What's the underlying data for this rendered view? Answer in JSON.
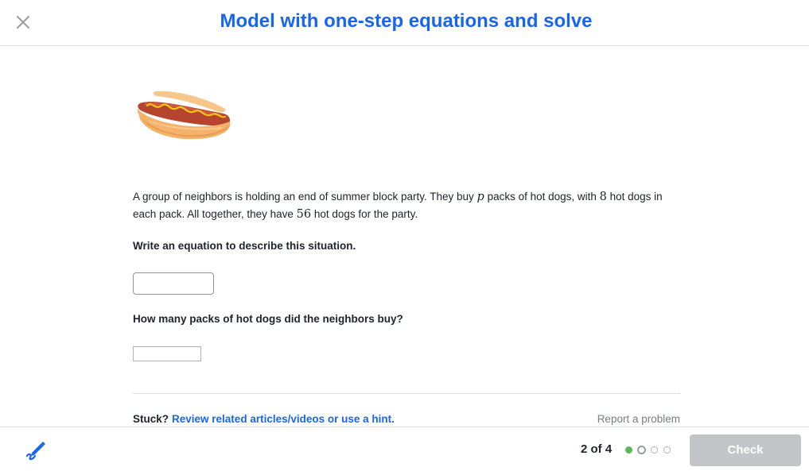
{
  "header": {
    "title": "Model with one-step equations and solve",
    "close_icon": "close-icon"
  },
  "problem": {
    "image_icon": "hot-dog-illustration",
    "text_part1": "A group of neighbors is holding an end of summer block party. They buy ",
    "var_p": "p",
    "text_part2": " packs of hot dogs, with ",
    "num_8": "8",
    "text_part3": " hot dogs in each pack. All together, they have ",
    "num_56": "56",
    "text_part4": " hot dogs for the party.",
    "question1": "Write an equation to describe this situation.",
    "answer1_value": "",
    "question2": "How many packs of hot dogs did the neighbors buy?",
    "answer2_value": ""
  },
  "help": {
    "stuck_label": "Stuck?",
    "stuck_link": "Review related articles/videos or use a hint.",
    "report_label": "Report a problem"
  },
  "footer": {
    "scratchpad_icon": "scratchpad-pencil-icon",
    "progress_text": "2 of 4",
    "total_steps": 4,
    "current_step": 2,
    "check_label": "Check"
  },
  "colors": {
    "accent": "#1865f2",
    "progress_complete": "#5cb85c",
    "check_disabled": "#c4c5c8"
  }
}
